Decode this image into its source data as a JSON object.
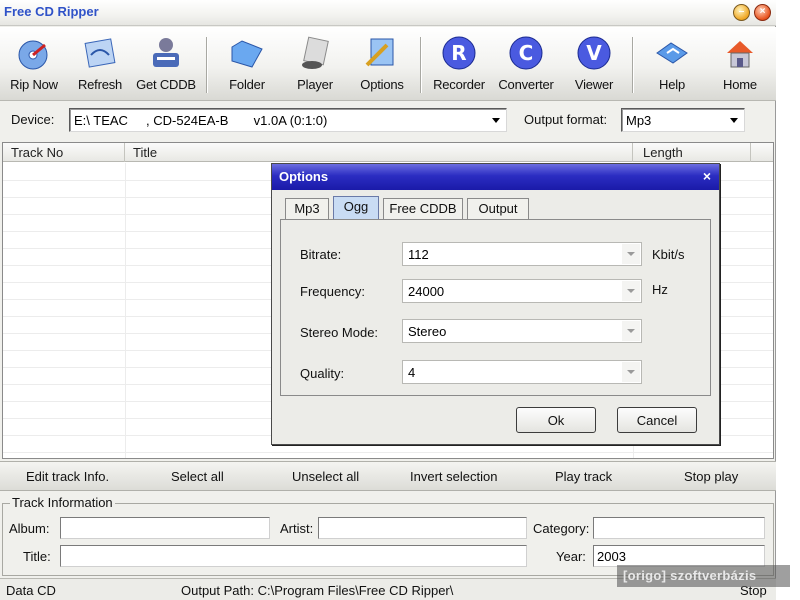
{
  "window": {
    "title": "Free CD Ripper",
    "minimize_glyph": "–",
    "close_glyph": "×"
  },
  "toolbar": {
    "buttons": [
      {
        "label": "Rip Now",
        "icon": "cd-rip-icon"
      },
      {
        "label": "Refresh",
        "icon": "refresh-icon"
      },
      {
        "label": "Get CDDB",
        "icon": "cddb-icon"
      },
      {
        "label": "Folder",
        "icon": "folder-icon"
      },
      {
        "label": "Player",
        "icon": "player-icon"
      },
      {
        "label": "Options",
        "icon": "options-icon"
      },
      {
        "label": "Recorder",
        "icon": "recorder-icon"
      },
      {
        "label": "Converter",
        "icon": "converter-icon"
      },
      {
        "label": "Viewer",
        "icon": "viewer-icon"
      },
      {
        "label": "Help",
        "icon": "help-icon"
      },
      {
        "label": "Home",
        "icon": "home-icon"
      }
    ]
  },
  "device": {
    "label": "Device:",
    "value": "E:\\ TEAC     , CD-524EA-B       v1.0A (0:1:0)",
    "output_format_label": "Output format:",
    "output_format_value": "Mp3"
  },
  "tracklist": {
    "columns": [
      "Track No",
      "Title",
      "Length"
    ]
  },
  "actions": [
    "Edit track Info.",
    "Select all",
    "Unselect all",
    "Invert selection",
    "Play track",
    "Stop play"
  ],
  "track_info": {
    "legend": "Track Information",
    "album_label": "Album:",
    "album_value": "",
    "artist_label": "Artist:",
    "artist_value": "",
    "category_label": "Category:",
    "category_value": "",
    "title_label": "Title:",
    "title_value": "",
    "year_label": "Year:",
    "year_value": "2003"
  },
  "status": {
    "left": "Data CD",
    "output_path": "Output Path:  C:\\Program Files\\Free CD Ripper\\",
    "right": "Stop"
  },
  "dialog": {
    "title": "Options",
    "close_glyph": "×",
    "tabs": [
      "Mp3",
      "Ogg",
      "Free CDDB",
      "Output"
    ],
    "active_tab": "Ogg",
    "fields": {
      "bitrate_label": "Bitrate:",
      "bitrate_value": "112",
      "bitrate_unit": "Kbit/s",
      "frequency_label": "Frequency:",
      "frequency_value": "24000",
      "frequency_unit": "Hz",
      "stereo_label": "Stereo Mode:",
      "stereo_value": "Stereo",
      "quality_label": "Quality:",
      "quality_value": "4"
    },
    "ok_label": "Ok",
    "cancel_label": "Cancel"
  },
  "watermark": "[origo] szoftverbázis",
  "colors": {
    "dialog_title": "#2b2dc2",
    "active_tab": "#c9dcf4",
    "app_title": "#2f52c8"
  }
}
